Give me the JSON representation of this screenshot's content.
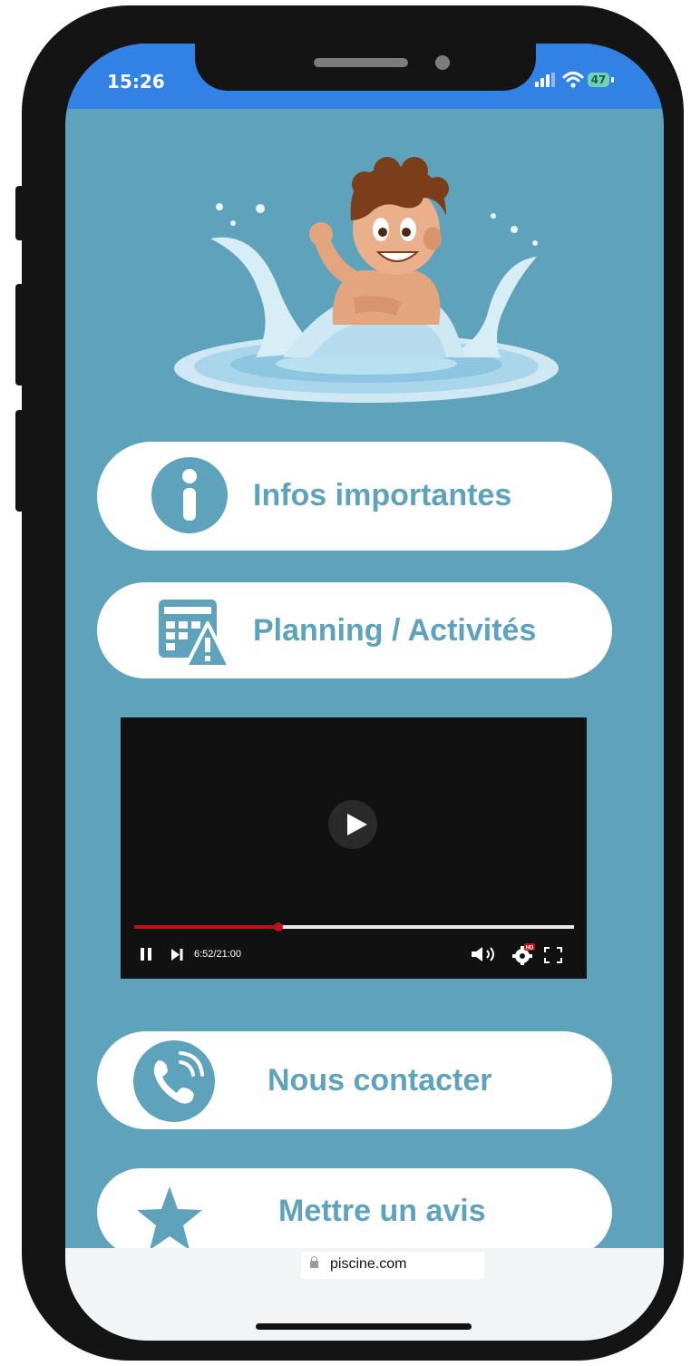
{
  "status_bar": {
    "time": "15:26",
    "battery": "47"
  },
  "menu": {
    "infos": "Infos importantes",
    "planning": "Planning / Activités",
    "contact": "Nous contacter",
    "review": "Mettre un avis"
  },
  "video": {
    "time_display": "6:52/21:00",
    "progress_fraction": 0.327
  },
  "browser": {
    "url": "piscine.com"
  },
  "colors": {
    "accent": "#5ea3bb",
    "status_bar": "#3282e6",
    "video_progress": "#c0111a"
  }
}
